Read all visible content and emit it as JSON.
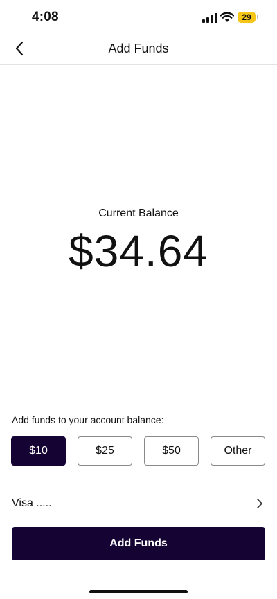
{
  "status_bar": {
    "time": "4:08",
    "battery_level": "29",
    "battery_color": "#f5c518"
  },
  "header": {
    "title": "Add Funds",
    "back_icon": "chevron-left-icon"
  },
  "balance": {
    "label": "Current Balance",
    "amount": "$34.64"
  },
  "amount_selector": {
    "prompt": "Add funds to your account balance:",
    "options": [
      {
        "label": "$10",
        "selected": true
      },
      {
        "label": "$25",
        "selected": false
      },
      {
        "label": "$50",
        "selected": false
      },
      {
        "label": "Other",
        "selected": false
      }
    ]
  },
  "payment_method": {
    "label": "Visa .....",
    "icon": "chevron-right-icon"
  },
  "primary_action": {
    "label": "Add Funds"
  },
  "colors": {
    "accent": "#150433",
    "divider": "#e3e3e3",
    "text": "#111111"
  }
}
